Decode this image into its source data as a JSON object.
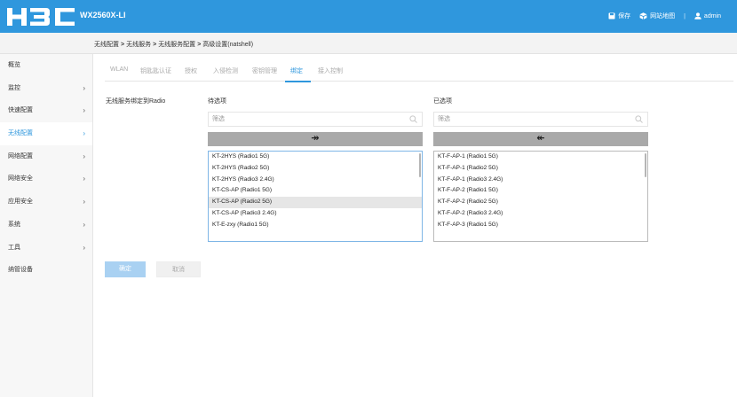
{
  "header": {
    "logo_text": "H3C",
    "device_model": "WX2560X-LI",
    "save_label": "保存",
    "sitemap_label": "网站地图",
    "separator": "|",
    "user_label": "admin"
  },
  "breadcrumb": {
    "items": [
      "无线配置",
      "无线服务",
      "无线服务配置",
      "高级设置(natshell)"
    ],
    "separator": ">"
  },
  "sidebar": {
    "items": [
      {
        "label": "概览",
        "arrow": ""
      },
      {
        "label": "监控",
        "arrow": "›"
      },
      {
        "label": "快速配置",
        "arrow": "›"
      },
      {
        "label": "无线配置",
        "arrow": "›"
      },
      {
        "label": "网络配置",
        "arrow": "›"
      },
      {
        "label": "网络安全",
        "arrow": "›"
      },
      {
        "label": "应用安全",
        "arrow": "›"
      },
      {
        "label": "系统",
        "arrow": "›"
      },
      {
        "label": "工具",
        "arrow": "›"
      },
      {
        "label": "纳管设备",
        "arrow": ""
      }
    ],
    "active_index": 3
  },
  "tabs": [
    {
      "label": "WLAN"
    },
    {
      "label": "钥匙匙认证"
    },
    {
      "label": "授权"
    },
    {
      "label": "入侵检测"
    },
    {
      "label": "密钥管理"
    },
    {
      "label": "绑定"
    },
    {
      "label": "接入控制"
    }
  ],
  "active_tab": 5,
  "form": {
    "field_label": "无线服务绑定到Radio",
    "available": {
      "title": "待选项",
      "filter_placeholder": "筛选",
      "move_button": "↠",
      "items": [
        "KT-2HYS (Radio1 5G)",
        "KT-2HYS (Radio2 5G)",
        "KT-2HYS (Radio3 2.4G)",
        "KT-CS-AP (Radio1 5G)",
        "KT-CS-AP (Radio2 5G)",
        "KT-CS-AP (Radio3 2.4G)",
        "KT-E-zxy (Radio1 5G)"
      ],
      "selected_index": 4
    },
    "selected": {
      "title": "已选项",
      "filter_placeholder": "筛选",
      "move_button": "↞",
      "items": [
        "KT-F-AP-1 (Radio1 5G)",
        "KT-F-AP-1 (Radio2 5G)",
        "KT-F-AP-1 (Radio3 2.4G)",
        "KT-F-AP-2 (Radio1 5G)",
        "KT-F-AP-2 (Radio2 5G)",
        "KT-F-AP-2 (Radio3 2.4G)",
        "KT-F-AP-3 (Radio1 5G)"
      ]
    }
  },
  "buttons": {
    "ok_label": "确定",
    "cancel_label": "取消"
  },
  "colors": {
    "header_bg": "#2f97dd",
    "accent": "#2f97dd",
    "move_button_bg": "#a9a9a9",
    "ok_button_bg": "#a9d1f2"
  }
}
